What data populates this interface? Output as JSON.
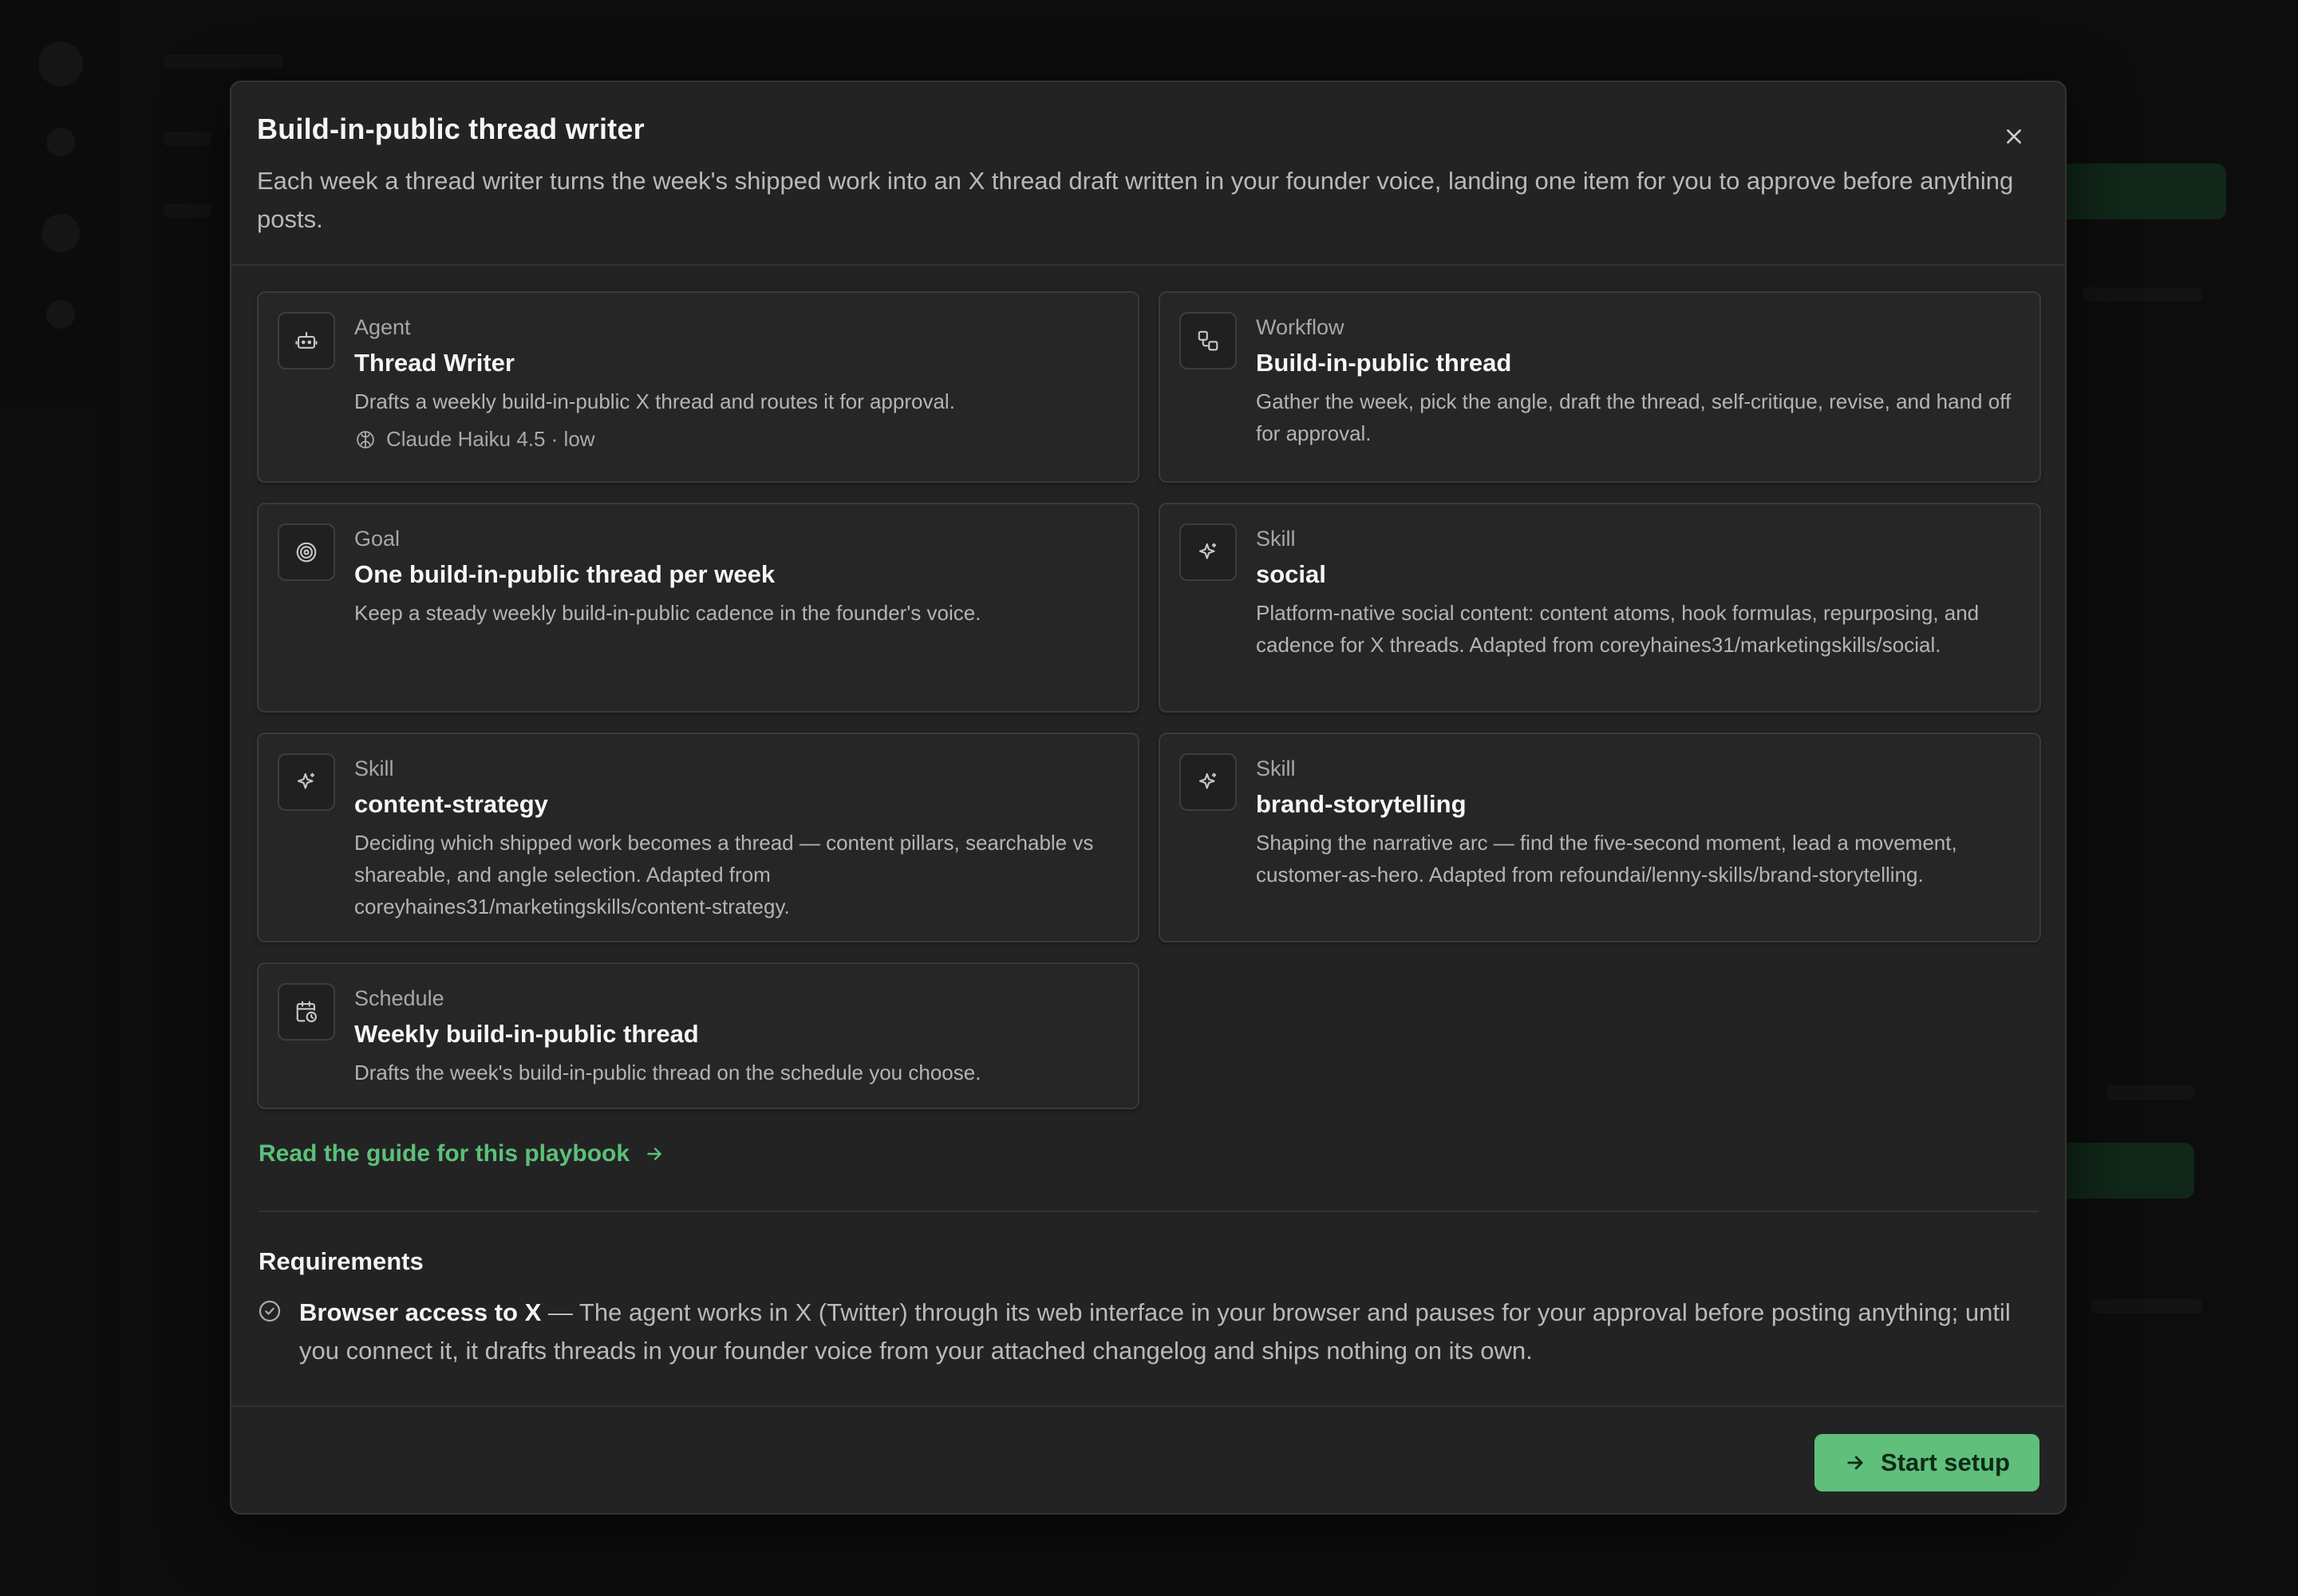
{
  "modal": {
    "title": "Build-in-public thread writer",
    "description": "Each week a thread writer turns the week's shipped work into an X thread draft written in your founder voice, landing one item for you to approve before anything posts.",
    "close_icon": "close-icon"
  },
  "cards": [
    {
      "kind": "Agent",
      "title": "Thread Writer",
      "description": "Drafts a weekly build-in-public X thread and routes it for approval.",
      "meta": "Claude Haiku 4.5 · low",
      "icon": "robot-icon"
    },
    {
      "kind": "Workflow",
      "title": "Build-in-public thread",
      "description": "Gather the week, pick the angle, draft the thread, self-critique, revise, and hand off for approval.",
      "icon": "workflow-icon"
    },
    {
      "kind": "Goal",
      "title": "One build-in-public thread per week",
      "description": "Keep a steady weekly build-in-public cadence in the founder's voice.",
      "icon": "target-icon"
    },
    {
      "kind": "Skill",
      "title": "social",
      "description": "Platform-native social content: content atoms, hook formulas, repurposing, and cadence for X threads. Adapted from coreyhaines31/marketingskills/social.",
      "icon": "sparkle-icon"
    },
    {
      "kind": "Skill",
      "title": "content-strategy",
      "description": "Deciding which shipped work becomes a thread — content pillars, searchable vs shareable, and angle selection. Adapted from coreyhaines31/marketingskills/content-strategy.",
      "icon": "sparkle-icon"
    },
    {
      "kind": "Skill",
      "title": "brand-storytelling",
      "description": "Shaping the narrative arc — find the five-second moment, lead a movement, customer-as-hero. Adapted from refoundai/lenny-skills/brand-storytelling.",
      "icon": "sparkle-icon"
    },
    {
      "kind": "Schedule",
      "title": "Weekly build-in-public thread",
      "description": "Drafts the week's build-in-public thread on the schedule you choose.",
      "icon": "calendar-clock-icon"
    }
  ],
  "guide_link": {
    "label": "Read the guide for this playbook",
    "icon": "arrow-right-icon"
  },
  "requirements": {
    "heading": "Requirements",
    "items": [
      {
        "title": "Browser access to X",
        "text": " — The agent works in X (Twitter) through its web interface in your browser and pauses for your approval before posting anything; until you connect it, it drafts threads in your founder voice from your attached changelog and ships nothing on its own.",
        "icon": "check-circle-icon"
      }
    ]
  },
  "footer": {
    "start_label": "Start setup",
    "start_icon": "arrow-right-icon"
  },
  "colors": {
    "accent": "#5fbf7b",
    "link": "#5cc07a",
    "modal_bg": "#232323",
    "card_bg": "#262626"
  }
}
